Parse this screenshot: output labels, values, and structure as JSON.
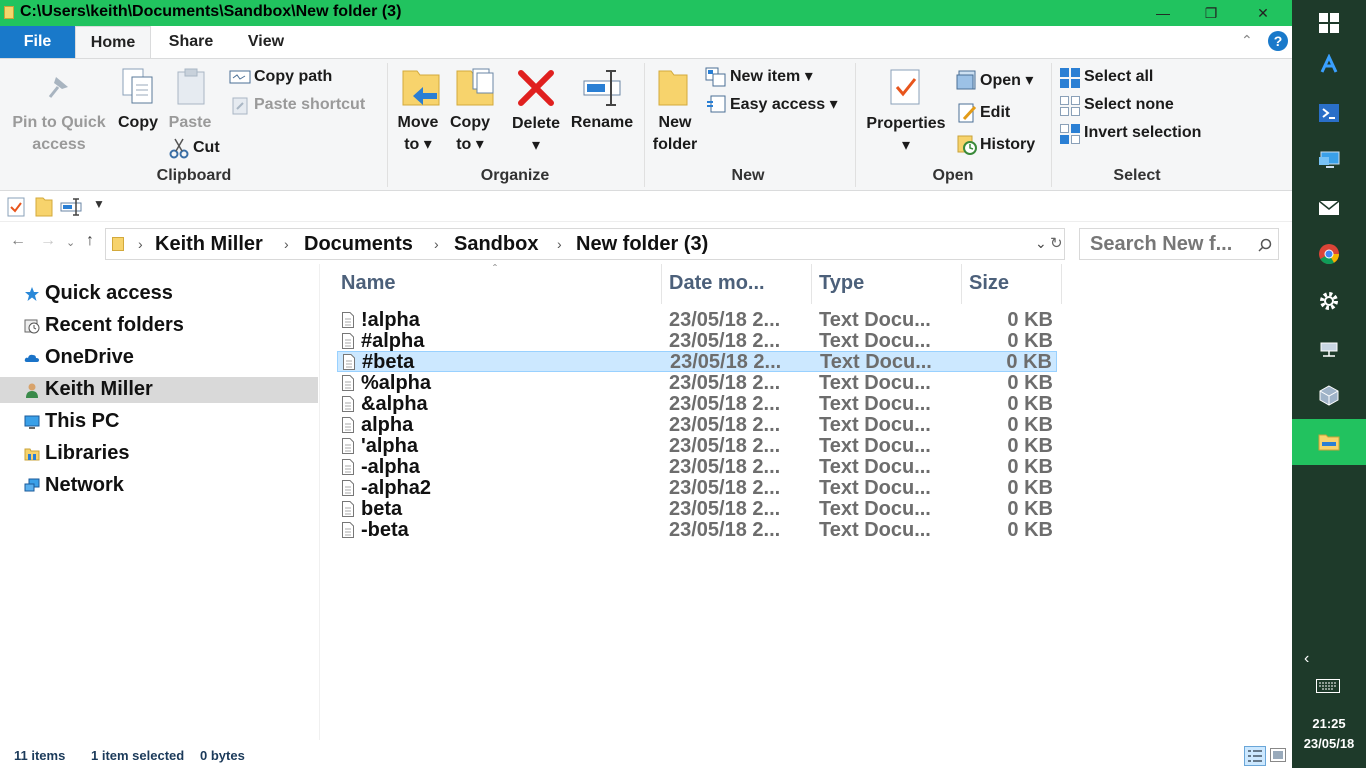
{
  "window": {
    "title": "C:\\Users\\keith\\Documents\\Sandbox\\New folder (3)"
  },
  "ribbon_tabs": {
    "file": "File",
    "home": "Home",
    "share": "Share",
    "view": "View"
  },
  "ribbon": {
    "clipboard": {
      "pin_line1": "Pin to Quick",
      "pin_line2": "access",
      "copy": "Copy",
      "paste": "Paste",
      "cut": "Cut",
      "copy_path": "Copy path",
      "paste_shortcut": "Paste shortcut",
      "label": "Clipboard"
    },
    "organize": {
      "move_line1": "Move",
      "move_line2": "to",
      "copy_line1": "Copy",
      "copy_line2": "to",
      "delete": "Delete",
      "rename": "Rename",
      "label": "Organize"
    },
    "new": {
      "folder_line1": "New",
      "folder_line2": "folder",
      "new_item": "New item",
      "easy_access": "Easy access",
      "label": "New"
    },
    "open": {
      "properties": "Properties",
      "open": "Open",
      "edit": "Edit",
      "history": "History",
      "label": "Open"
    },
    "select": {
      "select_all": "Select all",
      "select_none": "Select none",
      "invert": "Invert selection",
      "label": "Select"
    }
  },
  "address": {
    "crumbs": [
      "Keith Miller",
      "Documents",
      "Sandbox",
      "New folder (3)"
    ],
    "search_placeholder": "Search New f..."
  },
  "nav_pane": {
    "items": [
      "Quick access",
      "Recent folders",
      "OneDrive",
      "Keith Miller",
      "This PC",
      "Libraries",
      "Network"
    ],
    "selected": "Keith Miller"
  },
  "file_list": {
    "columns": [
      "Name",
      "Date mo...",
      "Type",
      "Size"
    ],
    "rows": [
      {
        "name": "!alpha",
        "date": "23/05/18 2...",
        "type": "Text Docu...",
        "size": "0 KB"
      },
      {
        "name": "#alpha",
        "date": "23/05/18 2...",
        "type": "Text Docu...",
        "size": "0 KB"
      },
      {
        "name": "#beta",
        "date": "23/05/18 2...",
        "type": "Text Docu...",
        "size": "0 KB"
      },
      {
        "name": "%alpha",
        "date": "23/05/18 2...",
        "type": "Text Docu...",
        "size": "0 KB"
      },
      {
        "name": "&alpha",
        "date": "23/05/18 2...",
        "type": "Text Docu...",
        "size": "0 KB"
      },
      {
        "name": "alpha",
        "date": "23/05/18 2...",
        "type": "Text Docu...",
        "size": "0 KB"
      },
      {
        "name": "'alpha",
        "date": "23/05/18 2...",
        "type": "Text Docu...",
        "size": "0 KB"
      },
      {
        "name": "-alpha",
        "date": "23/05/18 2...",
        "type": "Text Docu...",
        "size": "0 KB"
      },
      {
        "name": "-alpha2",
        "date": "23/05/18 2...",
        "type": "Text Docu...",
        "size": "0 KB"
      },
      {
        "name": "beta",
        "date": "23/05/18 2...",
        "type": "Text Docu...",
        "size": "0 KB"
      },
      {
        "name": "-beta",
        "date": "23/05/18 2...",
        "type": "Text Docu...",
        "size": "0 KB"
      }
    ],
    "selected": "#beta"
  },
  "status": {
    "items": "11 items",
    "selected": "1 item selected",
    "bytes": "0 bytes"
  },
  "taskbar": {
    "time": "21:25",
    "date": "23/05/18"
  },
  "colors": {
    "accent": "#1979ca",
    "titlebar": "#21c35f",
    "taskbar": "#1e3a2a",
    "selection": "#cce8ff"
  }
}
